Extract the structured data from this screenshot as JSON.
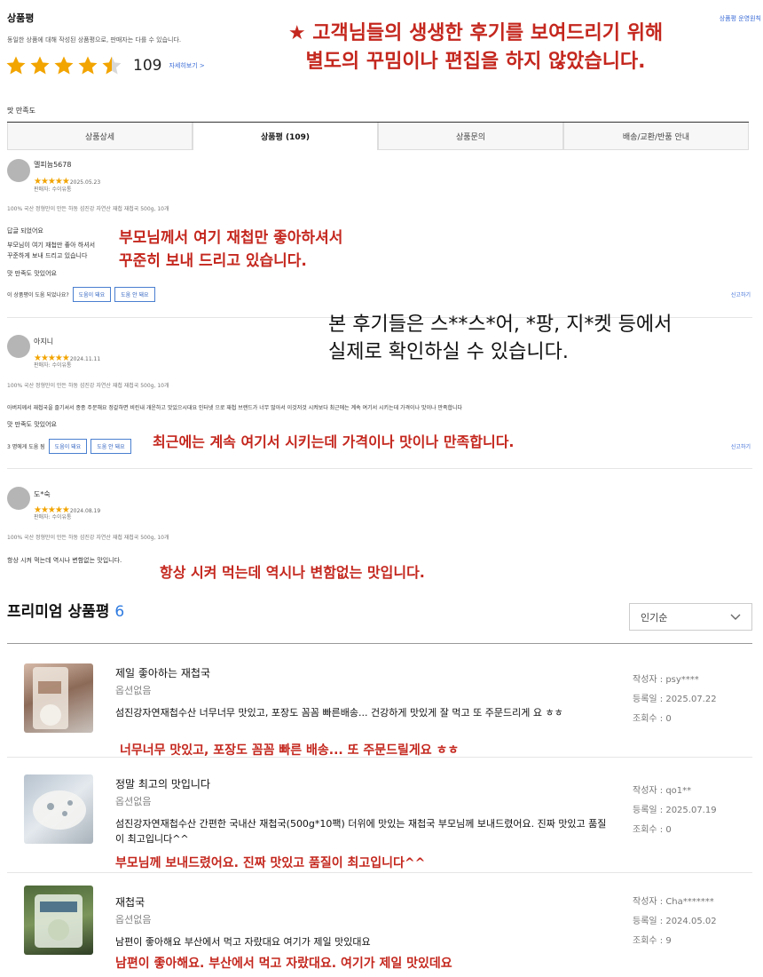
{
  "header": {
    "title": "상품평",
    "description": "동일한 상품에 대해 작성된 상품평으로, 판매자는 다를 수 있습니다.",
    "policy_link": "상품평 운영원칙",
    "review_count": "109",
    "view_more": "자세히보기 >",
    "banner_line1": "★ 고객님들의 생생한 후기를 보여드리기 위해",
    "banner_line2": "별도의 꾸밈이나 편집을 하지 않았습니다."
  },
  "taste_label": "맛 만족도",
  "tabs": [
    {
      "label": "상품상세"
    },
    {
      "label": "상품평 (109)"
    },
    {
      "label": "상품문의"
    },
    {
      "label": "배송/교환/반품 안내"
    }
  ],
  "reviews": [
    {
      "user": "멜피늄5678",
      "stars": "★★★★★",
      "date": "2025.05.23",
      "seller": "판매자: 수이유통",
      "product": "100% 국산 정형만이 만든 하동 섬진강 자연산 재첩 재첩국 500g, 10개",
      "headline": "답글 되었어요",
      "text1": "부모님이 여기 재첩만 좋아 하셔서",
      "text2": "꾸준하게 보내 드리고 있습니다",
      "taste": "맛 만족도    맛있어요",
      "helpful_q": "이 상품평이 도움 되었나요?",
      "btn_yes": "도움이 돼요",
      "btn_no": "도움 안 돼요",
      "report": "신고하기",
      "annot1": "부모님께서 여기 재첩만 좋아하셔서",
      "annot2": "꾸준히 보내 드리고 있습니다."
    },
    {
      "user": "아지니",
      "stars": "★★★★★",
      "date": "2024.11.11",
      "seller": "판매자: 수이유통",
      "product": "100% 국산 정형만이 만든 하동 섬진강 자연산 재첩 재첩국 500g, 10개",
      "text1": "아버지께서 재첩국을 즐기셔서 종종 주문해요 정갈하면 비린내 개운하고 맛있으시대요 인터넷 으로 재첩 브랜드가 너무 많아서 이것저것 시켜보다 최근에는 계속 여기서 시키는데 가격이나 맛이나 만족합니다",
      "taste": "맛 만족도    맛있어요",
      "helpful_q": "3 명에게 도움 됨",
      "btn_yes": "도움이 돼요",
      "btn_no": "도움 안 돼요",
      "report": "신고하기",
      "annot1": "최근에는 계속 여기서 시키는데 가격이나 맛이나 만족합니다."
    },
    {
      "user": "도*숙",
      "stars": "★★★★★",
      "date": "2024.08.19",
      "seller": "판매자: 수이유통",
      "product": "100% 국산 정형만이 만든 하동 섬진강 자연산 재첩 재첩국 500g, 10개",
      "text1": "항상 시켜 먹는데 역시나 변함없는 맛입니다.",
      "annot1": "항상 시켜 먹는데 역시나 변함없는 맛입니다."
    }
  ],
  "note_line1": "본 후기들은 스**스*어, *팡, 지*켓 등에서",
  "note_line2": "실제로 확인하실 수 있습니다.",
  "premium": {
    "title": "프리미엄 상품평",
    "count": "6",
    "sort": "인기순",
    "items": [
      {
        "title": "제일 좋아하는 재첩국",
        "option": "옵션없음",
        "body": "섬진강자연재첩수산 너무너무 맛있고, 포장도 꼼꼼 빠른배송... 건강하게 맛있게 잘 먹고 또 주문드리게 요 ㅎㅎ",
        "author": "작성자 : psy****",
        "date": "등록일 : 2025.07.22",
        "views": "조회수 : 0",
        "annot": "너무너무 맛있고, 포장도 꼼꼼 빠른 배송... 또 주문드릴게요 ㅎㅎ"
      },
      {
        "title": "정말 최고의 맛입니다",
        "option": "옵션없음",
        "body": "섬진강자연재첩수산 간편한 국내산 재첩국(500g*10팩) 더위에 맛있는 재첩국 부모님께 보내드렸어요. 진짜 맛있고 품질이 최고입니다^^",
        "author": "작성자 : qo1**",
        "date": "등록일 : 2025.07.19",
        "views": "조회수 : 0",
        "annot": "부모님께 보내드렸어요. 진짜 맛있고 품질이 최고입니다^^"
      },
      {
        "title": "재첩국",
        "option": "옵션없음",
        "body": "남편이 좋아해요 부산에서 먹고 자랐대요 여기가 제일 맛있대요",
        "author": "작성자 : Cha*******",
        "date": "등록일 : 2024.05.02",
        "views": "조회수 : 9",
        "annot": "남편이 좋아해요. 부산에서 먹고 자랐대요. 여기가 제일 맛있데요"
      }
    ]
  },
  "colors": {
    "accent": "#c4271e",
    "star": "#f2a400",
    "link": "#3a6bd6"
  },
  "rating_stars": 4.5
}
